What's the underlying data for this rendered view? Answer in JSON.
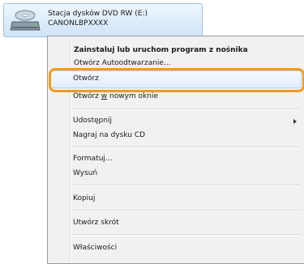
{
  "drive": {
    "name": "Stacja dysków DVD RW (E:)",
    "label": "CANONLBPXXXX",
    "icon": "dvd-drive-icon"
  },
  "menu": {
    "items": [
      {
        "label": "Zainstaluj lub uruchom program z nośnika",
        "bold": true
      },
      {
        "label": "Otwórz Autoodtwarzanie..."
      },
      {
        "label": "Otwórz"
      },
      {
        "label_pre": "Otwórz ",
        "label_u": "w",
        "label_post": " nowym oknie"
      },
      {
        "label": "Udostępnij",
        "submenu": true
      },
      {
        "label": "Nagraj na dysku CD"
      },
      {
        "label": "Formatuj..."
      },
      {
        "label": "Wysuń"
      },
      {
        "label": "Kopiuj"
      },
      {
        "label": "Utwórz skrót"
      },
      {
        "label": "Właściwości"
      }
    ]
  },
  "colors": {
    "highlight_outline": "#f39a1d",
    "selection_border": "#9fc4e6"
  }
}
